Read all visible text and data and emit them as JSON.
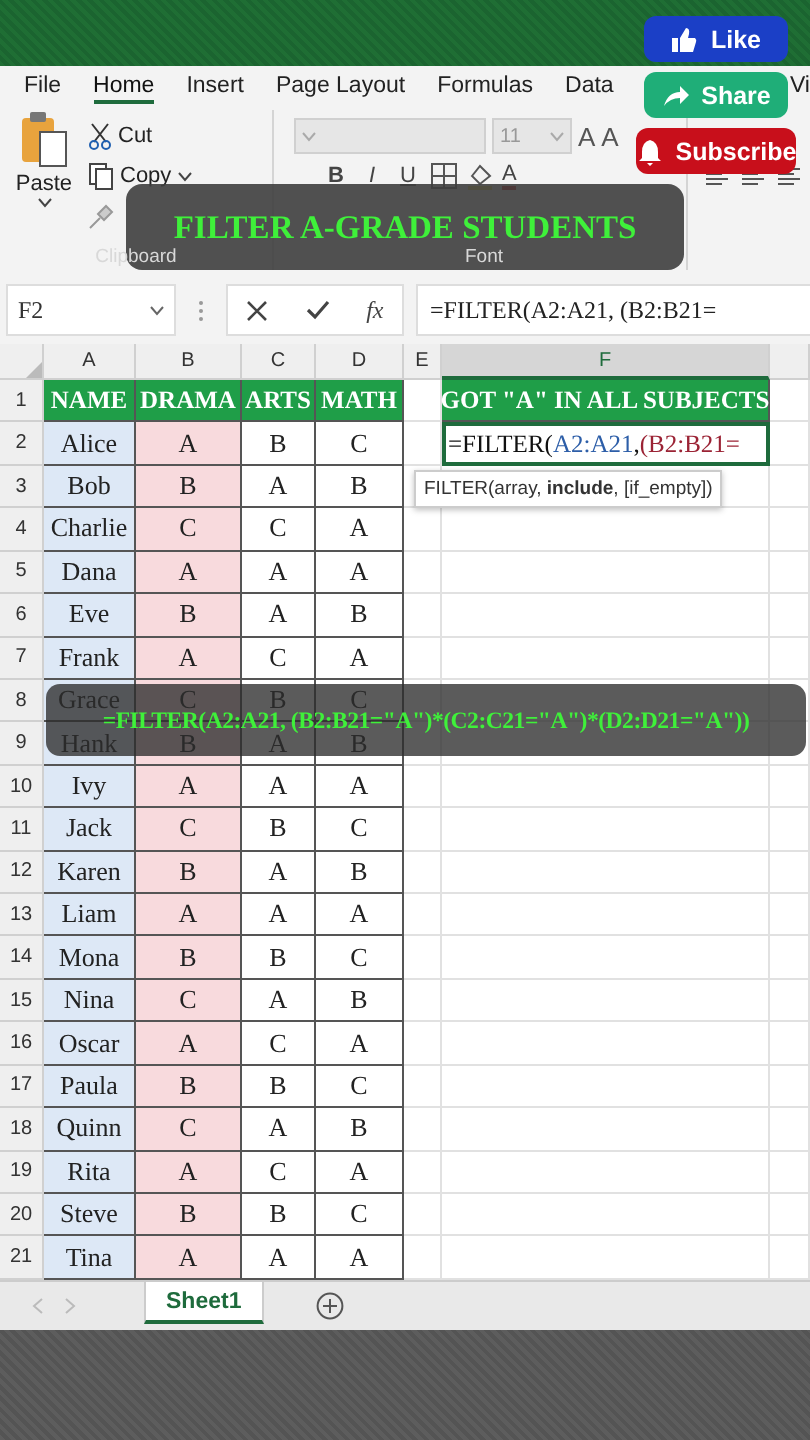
{
  "social_buttons": [
    {
      "label": "Like",
      "kind": "like"
    },
    {
      "label": "Share",
      "kind": "share"
    },
    {
      "label": "Subscribe",
      "kind": "subscribe"
    }
  ],
  "ribbon": {
    "tabs": [
      {
        "label": "File",
        "selected": false
      },
      {
        "label": "Home",
        "selected": true
      },
      {
        "label": "Insert",
        "selected": false
      },
      {
        "label": "Page Layout",
        "selected": false
      },
      {
        "label": "Formulas",
        "selected": false
      },
      {
        "label": "Data",
        "selected": false
      },
      {
        "label": "Vi",
        "selected": false
      }
    ],
    "clipboard": {
      "paste": "Paste",
      "cut": "Cut",
      "copy": "Copy",
      "group_label": "Clipboard"
    },
    "font": {
      "size": "11",
      "grow": "A",
      "shrink": "A",
      "bold": "B",
      "italic": "I",
      "underline": "U",
      "font_color": "A",
      "group_label": "Font"
    }
  },
  "title_banner": "FILTER A-GRADE STUDENTS",
  "formula_bar": {
    "name_box": "F2",
    "function_button": "fx",
    "formula": "=FILTER(A2:A21, (B2:B21="
  },
  "sheet": {
    "columns": [
      {
        "label": "A",
        "color": "#dde8f6",
        "selected": false
      },
      {
        "label": "B",
        "color": "#f8dadd",
        "selected": false
      },
      {
        "label": "C",
        "selected": false
      },
      {
        "label": "D",
        "selected": false
      },
      {
        "label": "E",
        "selected": false
      },
      {
        "label": "F",
        "selected": true
      }
    ],
    "header_row": {
      "number": "1",
      "cells": [
        "NAME",
        "DRAMA",
        "ARTS",
        "MATH"
      ],
      "result_header": "GOT \"A\" IN ALL SUBJECTS"
    },
    "editing_cell": [
      {
        "text": "=FILTER(",
        "kind": "plain"
      },
      {
        "text": "A2:A21",
        "kind": "ref_blue"
      },
      {
        "text": ", ",
        "kind": "plain"
      },
      {
        "text": "(B2:B21=",
        "kind": "ref_red"
      }
    ],
    "tooltip": "FILTER(array, **include**, [if_empty])",
    "rows": [
      {
        "number": "2",
        "cells": [
          "Alice",
          "A",
          "B",
          "C"
        ]
      },
      {
        "number": "3",
        "cells": [
          "Bob",
          "B",
          "A",
          "B"
        ]
      },
      {
        "number": "4",
        "cells": [
          "Charlie",
          "C",
          "C",
          "A"
        ]
      },
      {
        "number": "5",
        "cells": [
          "Dana",
          "A",
          "A",
          "A"
        ]
      },
      {
        "number": "6",
        "cells": [
          "Eve",
          "B",
          "A",
          "B"
        ]
      },
      {
        "number": "7",
        "cells": [
          "Frank",
          "A",
          "C",
          "A"
        ]
      },
      {
        "number": "8",
        "cells": [
          "Grace",
          "C",
          "B",
          "C"
        ]
      },
      {
        "number": "9",
        "cells": [
          "Hank",
          "B",
          "A",
          "B"
        ]
      },
      {
        "number": "10",
        "cells": [
          "Ivy",
          "A",
          "A",
          "A"
        ]
      },
      {
        "number": "11",
        "cells": [
          "Jack",
          "C",
          "B",
          "C"
        ]
      },
      {
        "number": "12",
        "cells": [
          "Karen",
          "B",
          "A",
          "B"
        ]
      },
      {
        "number": "13",
        "cells": [
          "Liam",
          "A",
          "A",
          "A"
        ]
      },
      {
        "number": "14",
        "cells": [
          "Mona",
          "B",
          "B",
          "C"
        ]
      },
      {
        "number": "15",
        "cells": [
          "Nina",
          "C",
          "A",
          "B"
        ]
      },
      {
        "number": "16",
        "cells": [
          "Oscar",
          "A",
          "C",
          "A"
        ]
      },
      {
        "number": "17",
        "cells": [
          "Paula",
          "B",
          "B",
          "C"
        ]
      },
      {
        "number": "18",
        "cells": [
          "Quinn",
          "C",
          "A",
          "B"
        ]
      },
      {
        "number": "19",
        "cells": [
          "Rita",
          "A",
          "C",
          "A"
        ]
      },
      {
        "number": "20",
        "cells": [
          "Steve",
          "B",
          "B",
          "C"
        ]
      },
      {
        "number": "21",
        "cells": [
          "Tina",
          "A",
          "A",
          "A"
        ]
      }
    ]
  },
  "formula_caption": "=FILTER(A2:A21, (B2:B21=\"A\")*(C2:C21=\"A\")*(D2:D21=\"A\"))",
  "sheet_tabs": [
    {
      "label": "Sheet1",
      "selected": true
    }
  ]
}
